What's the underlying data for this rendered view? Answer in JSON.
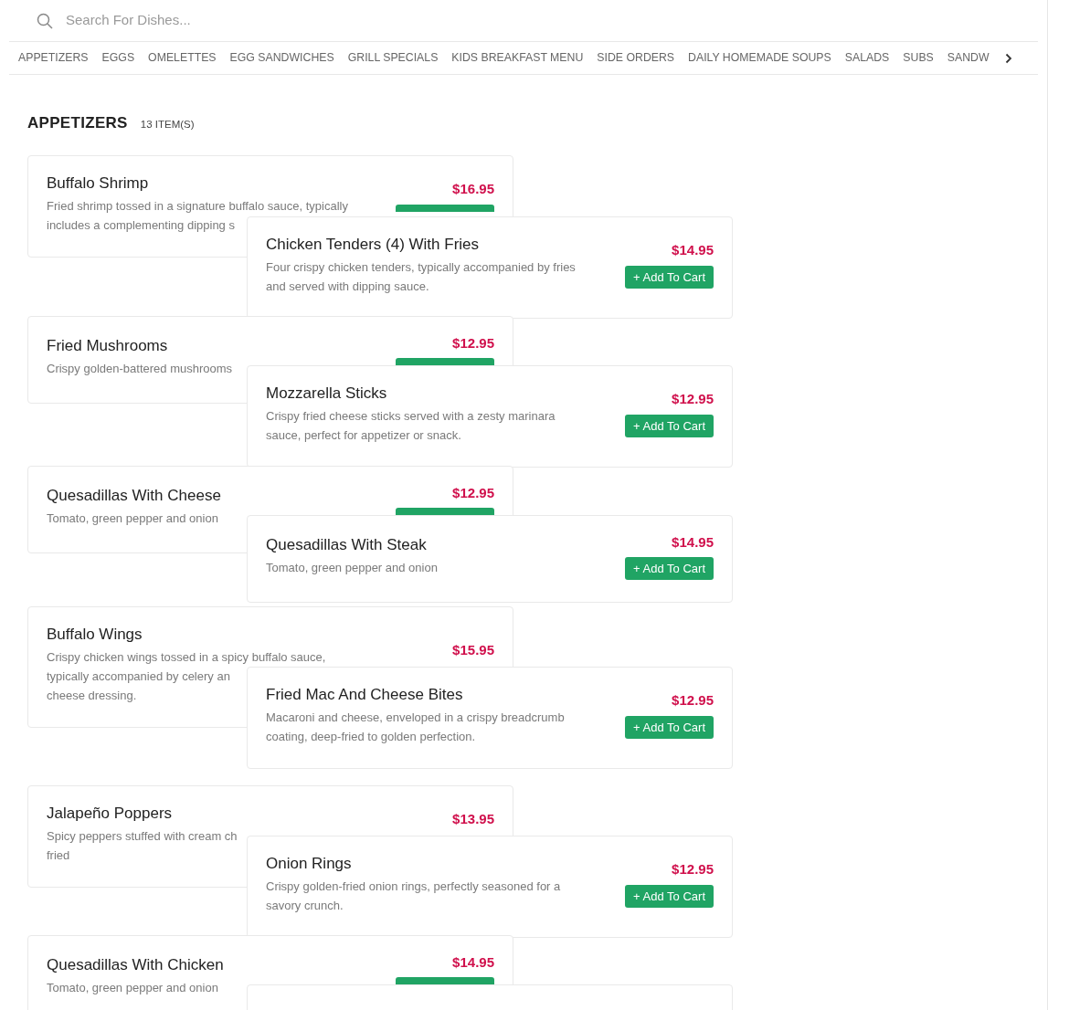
{
  "search": {
    "placeholder": "Search For Dishes..."
  },
  "categories": [
    {
      "label": "APPETIZERS"
    },
    {
      "label": "EGGS"
    },
    {
      "label": "OMELETTES"
    },
    {
      "label": "EGG SANDWICHES"
    },
    {
      "label": "GRILL SPECIALS"
    },
    {
      "label": "KIDS BREAKFAST MENU"
    },
    {
      "label": "SIDE ORDERS"
    },
    {
      "label": "DAILY HOMEMADE SOUPS"
    },
    {
      "label": "SALADS"
    },
    {
      "label": "SUBS"
    },
    {
      "label": "SANDW"
    }
  ],
  "section": {
    "title": "APPETIZERS",
    "count": "13 ITEM(S)"
  },
  "items": [
    {
      "kind": "under",
      "name": "Buffalo Shrimp",
      "description": [
        "Fried shrimp tossed in a signature buffalo sauce, typically",
        "includes a complementing dipping s"
      ],
      "price": "$16.95",
      "button_peek": true
    },
    {
      "kind": "over",
      "name": "Chicken Tenders (4) With Fries",
      "description": [
        "Four crispy chicken tenders, typically accompanied by fries",
        "and served with dipping sauce."
      ],
      "price": "$14.95",
      "button": "+ Add To Cart"
    },
    {
      "kind": "under",
      "name": "Fried Mushrooms",
      "description": [
        "Crispy golden-battered mushrooms"
      ],
      "price": "$12.95",
      "button_peek": true
    },
    {
      "kind": "over",
      "name": "Mozzarella Sticks",
      "description": [
        "Crispy fried cheese sticks served with a zesty marinara",
        "sauce, perfect for appetizer or snack."
      ],
      "price": "$12.95",
      "button": "+ Add To Cart"
    },
    {
      "kind": "under",
      "name": "Quesadillas With Cheese",
      "description": [
        "Tomato, green pepper and onion"
      ],
      "price": "$12.95",
      "button_peek": true
    },
    {
      "kind": "over",
      "name": "Quesadillas With Steak",
      "description": [
        "Tomato, green pepper and onion"
      ],
      "price": "$14.95",
      "button": "+ Add To Cart"
    },
    {
      "kind": "under",
      "name": "Buffalo Wings",
      "description": [
        "Crispy chicken wings tossed in a spicy buffalo sauce,",
        "typically accompanied by celery an",
        "cheese dressing."
      ],
      "price": "$15.95",
      "button_peek": false
    },
    {
      "kind": "over",
      "name": "Fried Mac And Cheese Bites",
      "description": [
        "Macaroni and cheese, enveloped in a crispy breadcrumb",
        "coating, deep-fried to golden perfection."
      ],
      "price": "$12.95",
      "button": "+ Add To Cart"
    },
    {
      "kind": "under",
      "name": "Jalapeño Poppers",
      "description": [
        "Spicy peppers stuffed with cream ch",
        "fried"
      ],
      "price": "$13.95",
      "button_peek": false
    },
    {
      "kind": "over",
      "name": "Onion Rings",
      "description": [
        "Crispy golden-fried onion rings, perfectly seasoned for a",
        "savory crunch."
      ],
      "price": "$12.95",
      "button": "+ Add To Cart"
    },
    {
      "kind": "under",
      "name": "Quesadillas With Chicken",
      "description": [
        "Tomato, green pepper and onion"
      ],
      "price": "$14.95",
      "button_peek": true
    },
    {
      "kind": "over"
    }
  ]
}
